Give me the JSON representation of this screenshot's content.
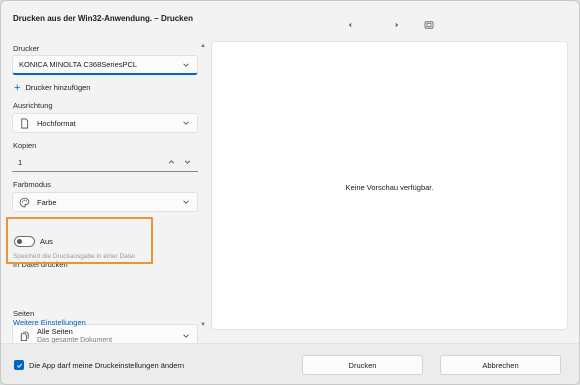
{
  "window": {
    "title": "Drucken aus der Win32-Anwendung. – Drucken"
  },
  "toolbar": {
    "prev_icon": "chevron-left-icon",
    "next_icon": "chevron-right-icon",
    "fit_icon": "fit-page-icon"
  },
  "printer": {
    "label": "Drucker",
    "selected": "KONICA MINOLTA C368SeriesPCL",
    "add_link": "Drucker hinzufügen"
  },
  "orientation": {
    "label": "Ausrichtung",
    "value": "Hochformat",
    "icon": "page-portrait-icon"
  },
  "copies": {
    "label": "Kopien",
    "value": "1"
  },
  "color_mode": {
    "label": "Farbmodus",
    "value": "Farbe",
    "icon": "palette-icon"
  },
  "print_to_file": {
    "label": "In Datei drucken",
    "toggle_state": "Aus",
    "hint": "Speichert die Druckausgabe in einer Datei"
  },
  "pages": {
    "label": "Seiten",
    "value": "Alle Seiten",
    "sub": "Das gesamte Dokument",
    "icon": "pages-icon"
  },
  "more_settings": {
    "label": "Weitere Einstellungen"
  },
  "preview": {
    "empty_text": "Keine Vorschau verfügbar."
  },
  "footer": {
    "checkbox_label": "Die App darf meine Druckeinstellungen ändern",
    "checkbox_checked": true,
    "print_button": "Drucken",
    "cancel_button": "Abbrechen"
  },
  "colors": {
    "accent": "#0067c0",
    "highlight": "#f0913a"
  }
}
